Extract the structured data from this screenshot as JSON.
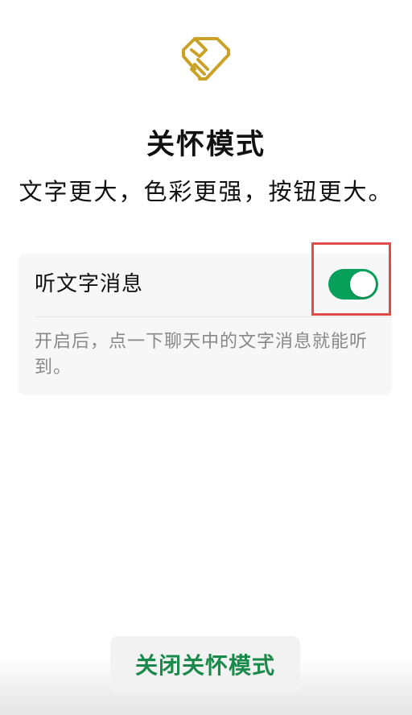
{
  "header": {
    "logo_icon": "care-hands-icon",
    "logo_color": "#c9a227",
    "title": "关怀模式",
    "subtitle": "文字更大，色彩更强，按钮更大。"
  },
  "setting": {
    "label": "听文字消息",
    "toggle_state": "on",
    "toggle_color": "#07a05a",
    "highlight_color": "#e34a4a",
    "description": "开启后，点一下聊天中的文字消息就能听到。"
  },
  "footer": {
    "close_label": "关闭关怀模式",
    "close_color": "#1a8a4b"
  }
}
